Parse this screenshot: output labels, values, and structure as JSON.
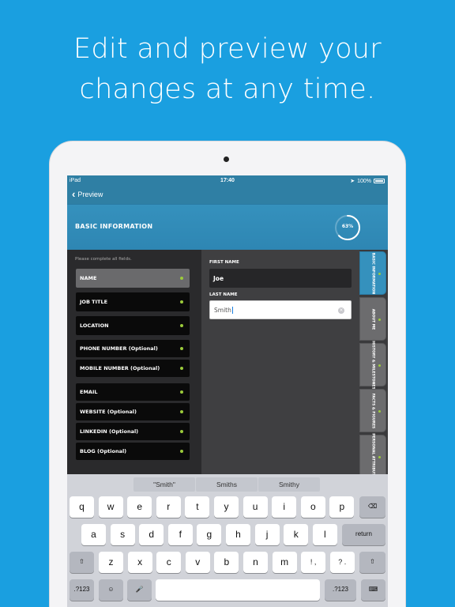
{
  "headline": {
    "line1": "Edit and preview your",
    "line2": "changes at any time."
  },
  "status_bar": {
    "device": "iPad",
    "time": "17:40",
    "battery": "100%"
  },
  "nav": {
    "back_label": "Preview"
  },
  "header": {
    "title": "BASIC INFORMATION",
    "progress_text": "63%",
    "progress": 0.63
  },
  "left_panel": {
    "instruction": "Please complete all fields.",
    "fields": [
      {
        "label": "NAME",
        "complete": true,
        "active": true
      },
      {
        "label": "JOB TITLE",
        "complete": true
      },
      {
        "label": "LOCATION",
        "complete": true
      },
      {
        "label": "PHONE NUMBER (Optional)",
        "complete": true
      },
      {
        "label": "MOBILE NUMBER (Optional)",
        "complete": true
      },
      {
        "label": "EMAIL",
        "complete": true
      },
      {
        "label": "WEBSITE (Optional)",
        "complete": true
      },
      {
        "label": "LINKEDIN (Optional)",
        "complete": true
      },
      {
        "label": "BLOG (Optional)",
        "complete": true
      }
    ]
  },
  "form": {
    "first_name_label": "FIRST NAME",
    "first_name_value": "Joe",
    "last_name_label": "LAST NAME",
    "last_name_value": "Smith"
  },
  "side_tabs": [
    {
      "label": "BASIC INFORMATION",
      "active": true
    },
    {
      "label": "ABOUT ME"
    },
    {
      "label": "HISTORY & MILESTONES"
    },
    {
      "label": "FACTS & FIGURES"
    },
    {
      "label": "PERSONAL ATTRIBUTES"
    }
  ],
  "keyboard": {
    "predictions": [
      "\"Smith\"",
      "Smiths",
      "Smithy"
    ],
    "row1": [
      "q",
      "w",
      "e",
      "r",
      "t",
      "y",
      "u",
      "i",
      "o",
      "p"
    ],
    "row2": [
      "a",
      "s",
      "d",
      "f",
      "g",
      "h",
      "j",
      "k",
      "l"
    ],
    "row3": [
      "z",
      "x",
      "c",
      "v",
      "b",
      "n",
      "m",
      "!\n,",
      "?\n."
    ],
    "return_label": "return",
    "numbers_label": ".?123",
    "colors": {
      "accent": "#1a9fe0",
      "brand_blue": "#3591bd",
      "complete_dot": "#9ccb3b"
    }
  }
}
